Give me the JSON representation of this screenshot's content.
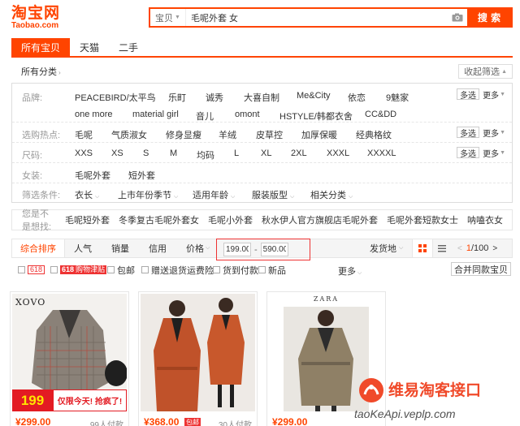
{
  "brand": {
    "name_cn": "淘宝网",
    "name_en": "Taobao.com",
    "color": "#ff4400"
  },
  "search": {
    "category": "宝贝",
    "query": "毛呢外套 女",
    "button": "搜 索",
    "camera_icon": "camera-icon"
  },
  "tabs": [
    {
      "label": "所有宝贝",
      "active": true
    },
    {
      "label": "天猫",
      "active": false
    },
    {
      "label": "二手",
      "active": false
    }
  ],
  "category_bar": {
    "all_label": "所有分类",
    "collapse_label": "收起筛选"
  },
  "filters": {
    "multi_label": "多选",
    "more_label": "更多",
    "brand": {
      "label": "品牌:",
      "row1": [
        "PEACEBIRD/太平鸟",
        "乐町",
        "诚秀",
        "大喜自制",
        "Me&City",
        "依恋",
        "9魅家"
      ],
      "row2": [
        "one more",
        "material girl",
        "音儿",
        "omont",
        "HSTYLE/韩都衣舍",
        "CC&DD"
      ]
    },
    "hot": {
      "label": "选购热点:",
      "items": [
        "毛呢",
        "气质淑女",
        "修身显瘦",
        "羊绒",
        "皮草控",
        "加厚保暖",
        "经典格纹"
      ]
    },
    "size": {
      "label": "尺码:",
      "items": [
        "XXS",
        "XS",
        "S",
        "M",
        "均码",
        "L",
        "XL",
        "2XL",
        "XXXL",
        "XXXXL"
      ]
    },
    "women": {
      "label": "女装:",
      "items": [
        "毛呢外套",
        "短外套"
      ]
    },
    "conditions": {
      "label": "筛选条件:",
      "items": [
        "衣长",
        "上市年份季节",
        "适用年龄",
        "服装版型",
        "相关分类"
      ]
    }
  },
  "suggest": {
    "label": "您是不是想找:",
    "items": [
      "毛呢短外套",
      "冬季复古毛呢外套女",
      "毛呢小外套",
      "秋水伊人官方旗舰店毛呢外套",
      "毛呢外套短款女士",
      "呐嗑衣女"
    ]
  },
  "sortbar": {
    "items": [
      "综合排序",
      "人气",
      "销量",
      "信用",
      "价格"
    ],
    "price_min": "199.00",
    "price_max": "590.00",
    "ship_from": "发货地",
    "page_current": "1",
    "page_total": "/100"
  },
  "subfilters": {
    "tag_618": "618",
    "tag_618_shopping": "618",
    "tag_618_shopping_text": "购物津贴",
    "items": [
      "包邮",
      "赠送退货运费险",
      "货到付款",
      "新品"
    ],
    "more": "更多",
    "merge": "合并同款宝贝"
  },
  "products": [
    {
      "price": "¥299.00",
      "count": "99人付款",
      "brand_text": "XOVO",
      "promo_price": "199",
      "promo_text": "仅限今天! 抢疯了!"
    },
    {
      "price": "¥368.00",
      "count": "30人付款",
      "tag": "包邮"
    },
    {
      "price": "¥299.00",
      "count": "",
      "brand_text": "ZARA"
    }
  ],
  "watermark": {
    "title": "维易淘客接口",
    "url": "taoKeApi.veplp.com"
  }
}
